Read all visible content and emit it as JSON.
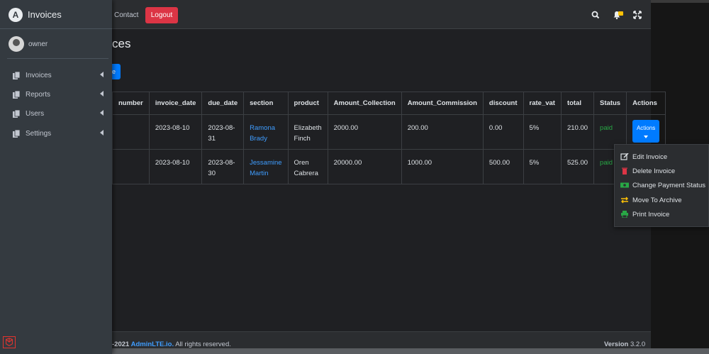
{
  "nav": {
    "contact": "Contact",
    "logout": "Logout"
  },
  "brand": {
    "title": "Invoices",
    "logo": "A"
  },
  "user": {
    "name": "owner"
  },
  "sidebar": {
    "items": [
      {
        "label": "Invoices",
        "icon": "copy-icon"
      },
      {
        "label": "Reports",
        "icon": "copy-icon"
      },
      {
        "label": "Users",
        "icon": "copy-icon"
      },
      {
        "label": "Settings",
        "icon": "copy-icon"
      }
    ]
  },
  "page": {
    "title_visible": "ces",
    "button_visible": "e"
  },
  "table": {
    "headers": [
      "number",
      "invoice_date",
      "due_date",
      "section",
      "product",
      "Amount_Collection",
      "Amount_Commission",
      "discount",
      "rate_vat",
      "total",
      "Status",
      "Actions"
    ],
    "rows": [
      {
        "number": "",
        "invoice_date": "2023-08-10",
        "due_date": "2023-08-31",
        "section": "Ramona Brady",
        "product": "Elizabeth Finch",
        "amount_collection": "2000.00",
        "amount_commission": "200.00",
        "discount": "0.00",
        "rate_vat": "5%",
        "total": "210.00",
        "status": "paid",
        "actions": "Actions"
      },
      {
        "number": "",
        "invoice_date": "2023-08-10",
        "due_date": "2023-08-30",
        "section": "Jessamine Martin",
        "product": "Oren Cabrera",
        "amount_collection": "20000.00",
        "amount_commission": "1000.00",
        "discount": "500.00",
        "rate_vat": "5%",
        "total": "525.00",
        "status": "paid"
      }
    ]
  },
  "dropdown": {
    "items": [
      {
        "label": "Edit Invoice",
        "color": "#dee2e6"
      },
      {
        "label": "Delete Invoice",
        "color": "#dc3545"
      },
      {
        "label": "Change Payment Status",
        "color": "#28a745"
      },
      {
        "label": "Move To Archive",
        "color": "#ffc107"
      },
      {
        "label": "Print Invoice",
        "color": "#28a745"
      }
    ]
  },
  "footer": {
    "copyright_prefix": "-2021 ",
    "link": "AdminLTE.io.",
    "suffix": " All rights reserved.",
    "version_label": "Version",
    "version": "3.2.0"
  },
  "colors": {
    "primary": "#007bff",
    "danger": "#dc3545",
    "success": "#28a745",
    "warning": "#ffc107"
  }
}
